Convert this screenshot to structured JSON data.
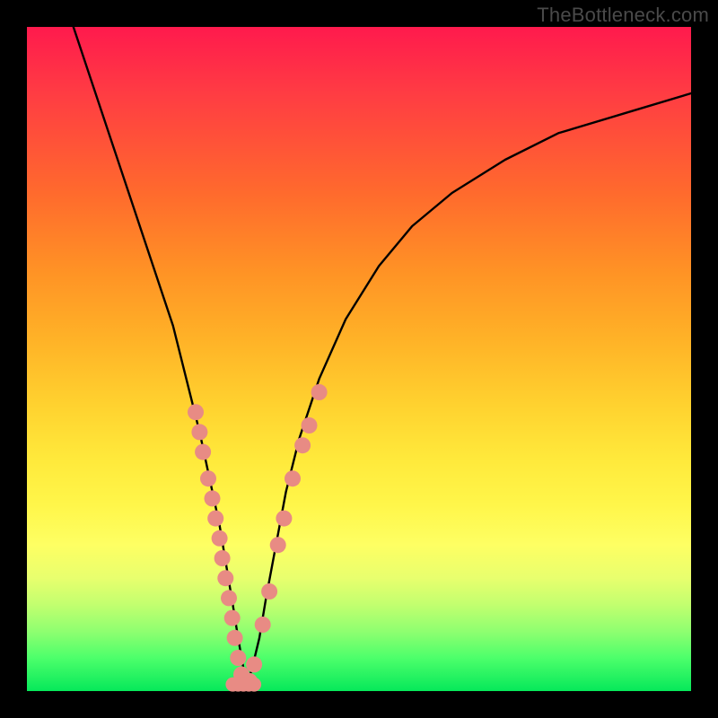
{
  "watermark": "TheBottleneck.com",
  "chart_data": {
    "type": "line",
    "title": "",
    "xlabel": "",
    "ylabel": "",
    "xlim": [
      0,
      100
    ],
    "ylim": [
      0,
      100
    ],
    "series": [
      {
        "name": "curve",
        "x": [
          7,
          10,
          13,
          16,
          19,
          22,
          24,
          26,
          27.5,
          29,
          30,
          31,
          31.8,
          32.5,
          33,
          33.8,
          35,
          36,
          37.5,
          39,
          41,
          44,
          48,
          53,
          58,
          64,
          72,
          80,
          90,
          100
        ],
        "y": [
          100,
          91,
          82,
          73,
          64,
          55,
          47,
          39,
          32,
          25,
          19,
          13,
          8,
          4,
          1,
          3,
          8,
          14,
          22,
          30,
          38,
          47,
          56,
          64,
          70,
          75,
          80,
          84,
          87,
          90
        ]
      }
    ],
    "markers_left": {
      "name": "left-branch-dots",
      "color": "#e88b84",
      "points": [
        {
          "x": 25.4,
          "y": 42
        },
        {
          "x": 26.0,
          "y": 39
        },
        {
          "x": 26.5,
          "y": 36
        },
        {
          "x": 27.3,
          "y": 32
        },
        {
          "x": 27.9,
          "y": 29
        },
        {
          "x": 28.4,
          "y": 26
        },
        {
          "x": 29.0,
          "y": 23
        },
        {
          "x": 29.4,
          "y": 20
        },
        {
          "x": 29.9,
          "y": 17
        },
        {
          "x": 30.4,
          "y": 14
        },
        {
          "x": 30.9,
          "y": 11
        },
        {
          "x": 31.3,
          "y": 8
        },
        {
          "x": 31.8,
          "y": 5
        },
        {
          "x": 32.3,
          "y": 2.5
        }
      ]
    },
    "markers_right": {
      "name": "right-branch-dots",
      "color": "#e88b84",
      "points": [
        {
          "x": 33.5,
          "y": 1.5
        },
        {
          "x": 34.2,
          "y": 4
        },
        {
          "x": 35.5,
          "y": 10
        },
        {
          "x": 36.5,
          "y": 15
        },
        {
          "x": 37.8,
          "y": 22
        },
        {
          "x": 38.7,
          "y": 26
        },
        {
          "x": 40.0,
          "y": 32
        },
        {
          "x": 41.5,
          "y": 37
        },
        {
          "x": 42.5,
          "y": 40
        },
        {
          "x": 44.0,
          "y": 45
        }
      ]
    },
    "bottom_run": {
      "name": "valley-floor-dots",
      "color": "#e88b84",
      "points": [
        {
          "x": 31.0,
          "y": 1
        },
        {
          "x": 31.8,
          "y": 1
        },
        {
          "x": 32.6,
          "y": 1
        },
        {
          "x": 33.4,
          "y": 1
        },
        {
          "x": 34.2,
          "y": 1
        }
      ]
    }
  }
}
